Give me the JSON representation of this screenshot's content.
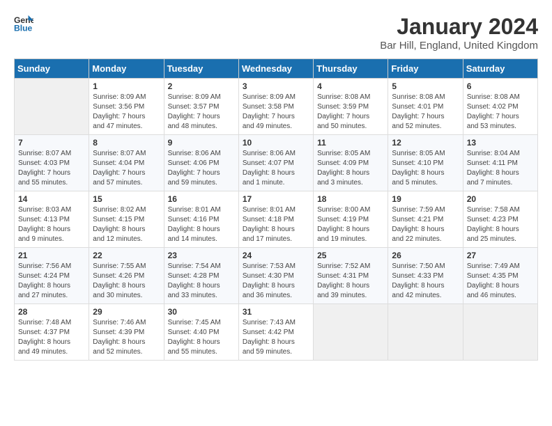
{
  "header": {
    "logo_general": "General",
    "logo_blue": "Blue",
    "title": "January 2024",
    "subtitle": "Bar Hill, England, United Kingdom"
  },
  "days_of_week": [
    "Sunday",
    "Monday",
    "Tuesday",
    "Wednesday",
    "Thursday",
    "Friday",
    "Saturday"
  ],
  "weeks": [
    [
      {
        "day": "",
        "info": ""
      },
      {
        "day": "1",
        "info": "Sunrise: 8:09 AM\nSunset: 3:56 PM\nDaylight: 7 hours\nand 47 minutes."
      },
      {
        "day": "2",
        "info": "Sunrise: 8:09 AM\nSunset: 3:57 PM\nDaylight: 7 hours\nand 48 minutes."
      },
      {
        "day": "3",
        "info": "Sunrise: 8:09 AM\nSunset: 3:58 PM\nDaylight: 7 hours\nand 49 minutes."
      },
      {
        "day": "4",
        "info": "Sunrise: 8:08 AM\nSunset: 3:59 PM\nDaylight: 7 hours\nand 50 minutes."
      },
      {
        "day": "5",
        "info": "Sunrise: 8:08 AM\nSunset: 4:01 PM\nDaylight: 7 hours\nand 52 minutes."
      },
      {
        "day": "6",
        "info": "Sunrise: 8:08 AM\nSunset: 4:02 PM\nDaylight: 7 hours\nand 53 minutes."
      }
    ],
    [
      {
        "day": "7",
        "info": "Sunrise: 8:07 AM\nSunset: 4:03 PM\nDaylight: 7 hours\nand 55 minutes."
      },
      {
        "day": "8",
        "info": "Sunrise: 8:07 AM\nSunset: 4:04 PM\nDaylight: 7 hours\nand 57 minutes."
      },
      {
        "day": "9",
        "info": "Sunrise: 8:06 AM\nSunset: 4:06 PM\nDaylight: 7 hours\nand 59 minutes."
      },
      {
        "day": "10",
        "info": "Sunrise: 8:06 AM\nSunset: 4:07 PM\nDaylight: 8 hours\nand 1 minute."
      },
      {
        "day": "11",
        "info": "Sunrise: 8:05 AM\nSunset: 4:09 PM\nDaylight: 8 hours\nand 3 minutes."
      },
      {
        "day": "12",
        "info": "Sunrise: 8:05 AM\nSunset: 4:10 PM\nDaylight: 8 hours\nand 5 minutes."
      },
      {
        "day": "13",
        "info": "Sunrise: 8:04 AM\nSunset: 4:11 PM\nDaylight: 8 hours\nand 7 minutes."
      }
    ],
    [
      {
        "day": "14",
        "info": "Sunrise: 8:03 AM\nSunset: 4:13 PM\nDaylight: 8 hours\nand 9 minutes."
      },
      {
        "day": "15",
        "info": "Sunrise: 8:02 AM\nSunset: 4:15 PM\nDaylight: 8 hours\nand 12 minutes."
      },
      {
        "day": "16",
        "info": "Sunrise: 8:01 AM\nSunset: 4:16 PM\nDaylight: 8 hours\nand 14 minutes."
      },
      {
        "day": "17",
        "info": "Sunrise: 8:01 AM\nSunset: 4:18 PM\nDaylight: 8 hours\nand 17 minutes."
      },
      {
        "day": "18",
        "info": "Sunrise: 8:00 AM\nSunset: 4:19 PM\nDaylight: 8 hours\nand 19 minutes."
      },
      {
        "day": "19",
        "info": "Sunrise: 7:59 AM\nSunset: 4:21 PM\nDaylight: 8 hours\nand 22 minutes."
      },
      {
        "day": "20",
        "info": "Sunrise: 7:58 AM\nSunset: 4:23 PM\nDaylight: 8 hours\nand 25 minutes."
      }
    ],
    [
      {
        "day": "21",
        "info": "Sunrise: 7:56 AM\nSunset: 4:24 PM\nDaylight: 8 hours\nand 27 minutes."
      },
      {
        "day": "22",
        "info": "Sunrise: 7:55 AM\nSunset: 4:26 PM\nDaylight: 8 hours\nand 30 minutes."
      },
      {
        "day": "23",
        "info": "Sunrise: 7:54 AM\nSunset: 4:28 PM\nDaylight: 8 hours\nand 33 minutes."
      },
      {
        "day": "24",
        "info": "Sunrise: 7:53 AM\nSunset: 4:30 PM\nDaylight: 8 hours\nand 36 minutes."
      },
      {
        "day": "25",
        "info": "Sunrise: 7:52 AM\nSunset: 4:31 PM\nDaylight: 8 hours\nand 39 minutes."
      },
      {
        "day": "26",
        "info": "Sunrise: 7:50 AM\nSunset: 4:33 PM\nDaylight: 8 hours\nand 42 minutes."
      },
      {
        "day": "27",
        "info": "Sunrise: 7:49 AM\nSunset: 4:35 PM\nDaylight: 8 hours\nand 46 minutes."
      }
    ],
    [
      {
        "day": "28",
        "info": "Sunrise: 7:48 AM\nSunset: 4:37 PM\nDaylight: 8 hours\nand 49 minutes."
      },
      {
        "day": "29",
        "info": "Sunrise: 7:46 AM\nSunset: 4:39 PM\nDaylight: 8 hours\nand 52 minutes."
      },
      {
        "day": "30",
        "info": "Sunrise: 7:45 AM\nSunset: 4:40 PM\nDaylight: 8 hours\nand 55 minutes."
      },
      {
        "day": "31",
        "info": "Sunrise: 7:43 AM\nSunset: 4:42 PM\nDaylight: 8 hours\nand 59 minutes."
      },
      {
        "day": "",
        "info": ""
      },
      {
        "day": "",
        "info": ""
      },
      {
        "day": "",
        "info": ""
      }
    ]
  ]
}
